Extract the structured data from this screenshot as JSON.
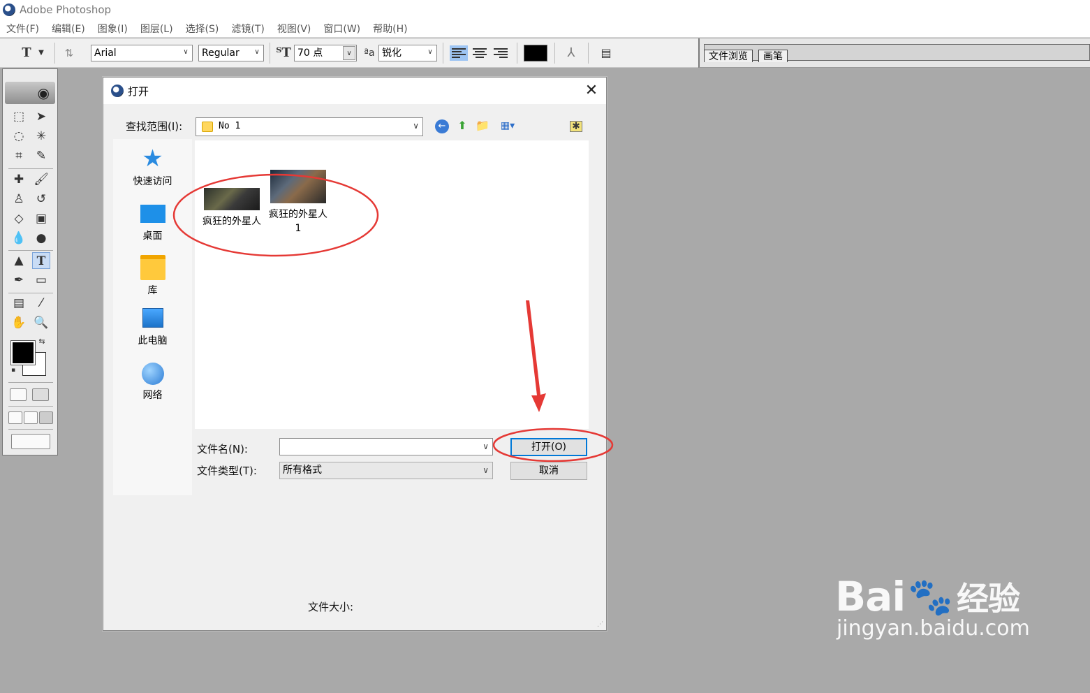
{
  "app": {
    "title": "Adobe Photoshop"
  },
  "menu": [
    "文件(F)",
    "编辑(E)",
    "图象(I)",
    "图层(L)",
    "选择(S)",
    "滤镜(T)",
    "视图(V)",
    "窗口(W)",
    "帮助(H)"
  ],
  "options": {
    "font_family": "Arial",
    "font_style": "Regular",
    "font_size": "70 点",
    "antialias": "锐化"
  },
  "palette_tabs": [
    "文件浏览",
    "画笔"
  ],
  "dialog": {
    "title": "打开",
    "look_in_label": "查找范围(I):",
    "look_in_value": "No 1",
    "places": [
      "快速访问",
      "桌面",
      "库",
      "此电脑",
      "网络"
    ],
    "files": [
      {
        "name": "疯狂的外星人"
      },
      {
        "name": "疯狂的外星人 1"
      }
    ],
    "file_name_label": "文件名(N):",
    "file_name_value": "",
    "file_type_label": "文件类型(T):",
    "file_type_value": "所有格式",
    "open_button": "打开(O)",
    "cancel_button": "取消",
    "file_size_label": "文件大小:"
  },
  "watermark": {
    "brand": "Bai",
    "brand2": "经验",
    "url": "jingyan.baidu.com"
  },
  "colors": {
    "annotation_red": "#e53935",
    "selection_blue": "#0078d7"
  }
}
